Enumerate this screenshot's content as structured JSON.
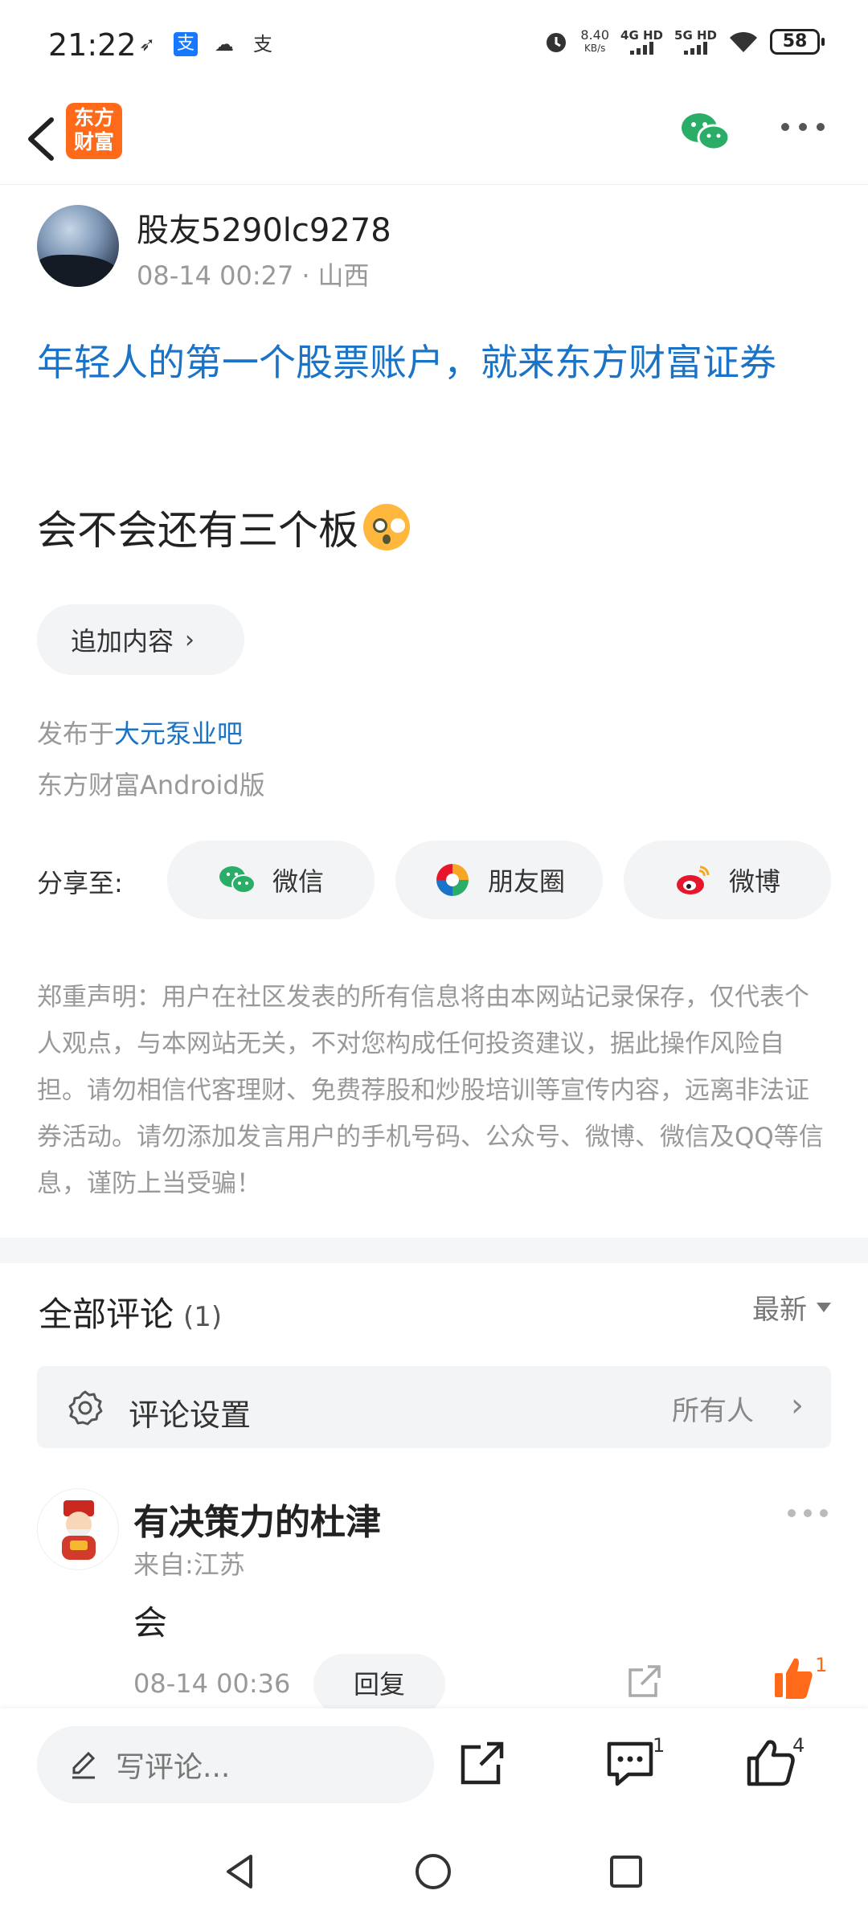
{
  "status_bar": {
    "time": "21:22",
    "left_icons": [
      "navigation-icon",
      "alipay-icon",
      "cloud-icon",
      "alipay-text-icon"
    ],
    "speed_value": "8.40",
    "speed_unit": "KB/s",
    "signal_1": "4G HD",
    "signal_2": "5G HD",
    "battery": "58"
  },
  "nav": {
    "logo_text_line1": "东方",
    "logo_text_line2": "财富"
  },
  "post": {
    "author": "股友5290lc9278",
    "date": "08-14 00:27",
    "separator": "·",
    "location": "山西",
    "promo_title": "年轻人的第一个股票账户，就来东方财富证券",
    "body": "会不会还有三个板",
    "append_label": "追加内容",
    "published_prefix": "发布于",
    "forum": "大元泵业吧",
    "client": "东方财富Android版"
  },
  "share": {
    "label": "分享至:",
    "options": [
      {
        "label": "微信",
        "icon": "wechat-icon",
        "color": "#2aae67"
      },
      {
        "label": "朋友圈",
        "icon": "moments-icon",
        "color": "#f5a623"
      },
      {
        "label": "微博",
        "icon": "weibo-icon",
        "color": "#e6162d"
      }
    ]
  },
  "disclaimer": "郑重声明：用户在社区发表的所有信息将由本网站记录保存，仅代表个人观点，与本网站无关，不对您构成任何投资建议，据此操作风险自担。请勿相信代客理财、免费荐股和炒股培训等宣传内容，远离非法证券活动。请勿添加发言用户的手机号码、公众号、微博、微信及QQ等信息，谨防上当受骗！",
  "comments": {
    "title": "全部评论",
    "count": "(1)",
    "sort": "最新",
    "settings_label": "评论设置",
    "settings_value": "所有人",
    "items": [
      {
        "name": "有决策力的杜津",
        "from": "来自:江苏",
        "text": "会",
        "time": "08-14 00:36",
        "reply_label": "回复",
        "likes": "1"
      }
    ]
  },
  "bottom_bar": {
    "write_placeholder": "写评论...",
    "comment_count": "1",
    "like_count": "4"
  },
  "colors": {
    "accent_blue": "#1a73c6",
    "brand_orange": "#ff6a1a",
    "muted_text": "#999999"
  }
}
